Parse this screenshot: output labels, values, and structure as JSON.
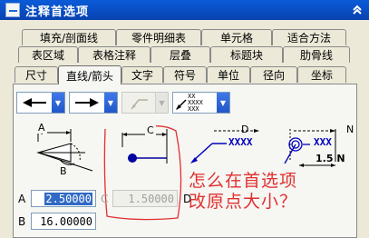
{
  "window": {
    "title": "注释首选项",
    "collapse_icon": "double-chevron-up-icon"
  },
  "tabs": {
    "row1": [
      "填充/剖面线",
      "零件明细表",
      "单元格",
      "适合方法"
    ],
    "row2": [
      "表区域",
      "表格注释",
      "层叠",
      "标题块",
      "肋骨线"
    ],
    "row3": [
      "尺寸",
      "直线/箭头",
      "文字",
      "符号",
      "单位",
      "径向",
      "坐标"
    ],
    "active": "直线/箭头"
  },
  "arrows": {
    "left_dropdown": {
      "icon": "filled-arrow-left-icon"
    },
    "right_dropdown": {
      "icon": "filled-arrow-right-icon"
    },
    "elbow_dropdown": {
      "icon": "elbow-leader-icon",
      "disabled": true
    },
    "leader_dropdown": {
      "icon": "leader-xx-icon",
      "preview_text": [
        "XX",
        "XXXX",
        "XXX"
      ]
    }
  },
  "diagrams": {
    "d1": {
      "top_label": "A",
      "angle_label": "B"
    },
    "d2": {
      "top_label": "C"
    },
    "d3": {
      "top_label": "D",
      "text": "XXXX"
    },
    "d4": {
      "top_label": "N",
      "text": "XXX",
      "bottom_label": "1.5 N"
    }
  },
  "fields": {
    "a": {
      "label": "A",
      "value": "2.50000"
    },
    "c": {
      "label": "C",
      "value": "1.50000",
      "disabled": true
    },
    "d": {
      "label": "D"
    },
    "b": {
      "label": "B",
      "value": "16.00000"
    }
  },
  "annotation": {
    "line1": "怎么在首选项",
    "line2": "改原点大小？"
  },
  "colors": {
    "titlebar": "#0a5bd8",
    "annotation": "#e03030",
    "selection": "#316ac5",
    "dropdown_button": "#2f66d8"
  }
}
